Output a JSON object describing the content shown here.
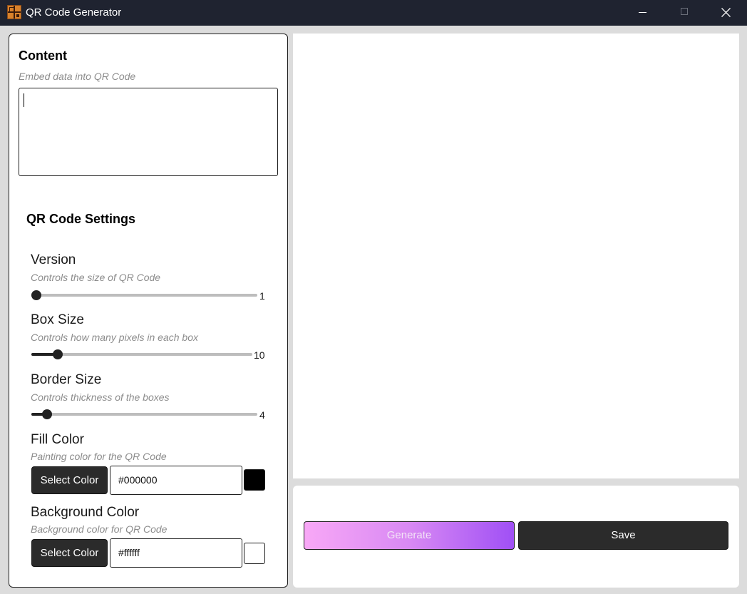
{
  "window": {
    "title": "QR Code Generator"
  },
  "content": {
    "title": "Content",
    "hint": "Embed data into QR Code",
    "value": ""
  },
  "settings": {
    "title": "QR Code Settings",
    "version": {
      "label": "Version",
      "hint": "Controls the size of QR Code",
      "value": "1",
      "fraction": 0.0
    },
    "box_size": {
      "label": "Box Size",
      "hint": "Controls how many pixels in each box",
      "value": "10",
      "fraction": 0.1
    },
    "border_size": {
      "label": "Border Size",
      "hint": "Controls thickness of the boxes",
      "value": "4",
      "fraction": 0.05
    },
    "fill_color": {
      "label": "Fill Color",
      "hint": "Painting color for the QR Code",
      "button_label": "Select Color",
      "value": "#000000",
      "swatch": "#000000"
    },
    "background_color": {
      "label": "Background Color",
      "hint": "Background color for QR Code",
      "button_label": "Select Color",
      "value": "#ffffff",
      "swatch": "#ffffff"
    }
  },
  "actions": {
    "generate_label": "Generate",
    "save_label": "Save"
  },
  "colors": {
    "titlebar": "#1f2330",
    "button_dark": "#2b2b2b",
    "generate_gradient_start": "#f8a8f6",
    "generate_gradient_end": "#a050f5"
  },
  "icons": {
    "app": "qr-app-icon",
    "minimize": "minimize-icon",
    "maximize": "maximize-icon",
    "close": "close-icon"
  }
}
